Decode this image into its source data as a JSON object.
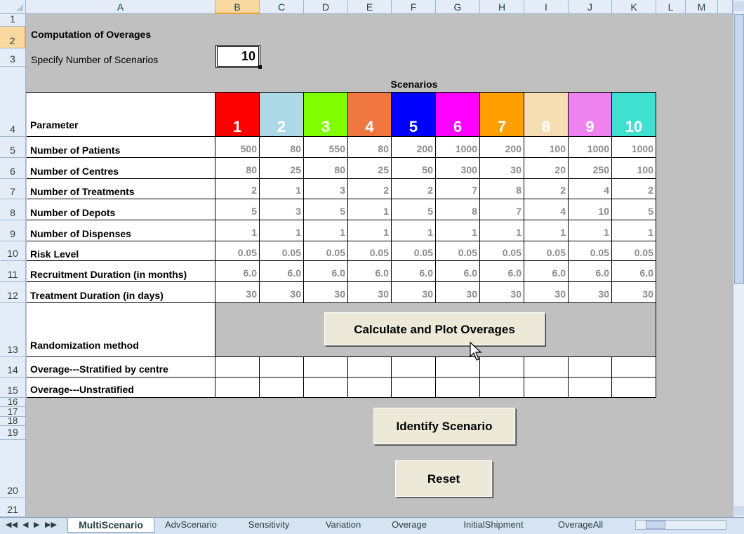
{
  "columns": [
    "A",
    "B",
    "C",
    "D",
    "E",
    "F",
    "G",
    "H",
    "I",
    "J",
    "K",
    "L",
    "M"
  ],
  "rows": [
    "1",
    "2",
    "3",
    "4",
    "5",
    "6",
    "7",
    "8",
    "9",
    "10",
    "11",
    "12",
    "13",
    "14",
    "15",
    "16",
    "17",
    "18",
    "19",
    "20",
    "21"
  ],
  "title": "Computation of Overages",
  "scenario_count_label": "Specify Number of Scenarios",
  "scenario_count_value": "10",
  "scenarios_header": "Scenarios",
  "parameter_label": "Parameter",
  "scenario_numbers": [
    "1",
    "2",
    "3",
    "4",
    "5",
    "6",
    "7",
    "8",
    "9",
    "10"
  ],
  "scenario_colors": [
    "#ff0000",
    "#add8e6",
    "#80ff00",
    "#f07840",
    "#0000ff",
    "#ff00ff",
    "#ffa000",
    "#f5deb3",
    "#ee82ee",
    "#40e0d0"
  ],
  "parameters": [
    {
      "label": "Number of Patients",
      "values": [
        "500",
        "80",
        "550",
        "80",
        "200",
        "1000",
        "200",
        "100",
        "1000",
        "1000"
      ]
    },
    {
      "label": "Number of Centres",
      "values": [
        "80",
        "25",
        "80",
        "25",
        "50",
        "300",
        "30",
        "20",
        "250",
        "100"
      ]
    },
    {
      "label": "Number of Treatments",
      "values": [
        "2",
        "1",
        "3",
        "2",
        "2",
        "7",
        "8",
        "2",
        "4",
        "2"
      ]
    },
    {
      "label": "Number of Depots",
      "values": [
        "5",
        "3",
        "5",
        "1",
        "5",
        "8",
        "7",
        "4",
        "10",
        "5"
      ]
    },
    {
      "label": "Number of Dispenses",
      "values": [
        "1",
        "1",
        "1",
        "1",
        "1",
        "1",
        "1",
        "1",
        "1",
        "1"
      ]
    },
    {
      "label": "Risk Level",
      "values": [
        "0.05",
        "0.05",
        "0.05",
        "0.05",
        "0.05",
        "0.05",
        "0.05",
        "0.05",
        "0.05",
        "0.05"
      ]
    },
    {
      "label": "Recruitment Duration (in months)",
      "values": [
        "6.0",
        "6.0",
        "6.0",
        "6.0",
        "6.0",
        "6.0",
        "6.0",
        "6.0",
        "6.0",
        "6.0"
      ]
    },
    {
      "label": "Treatment Duration (in days)",
      "values": [
        "30",
        "30",
        "30",
        "30",
        "30",
        "30",
        "30",
        "30",
        "30",
        "30"
      ]
    }
  ],
  "randomization_label": "Randomization method",
  "overage_stratified_label": "Overage---Stratified by centre",
  "overage_unstratified_label": "Overage---Unstratified",
  "buttons": {
    "calculate": "Calculate and Plot Overages",
    "identify": "Identify Scenario",
    "reset": "Reset"
  },
  "sheet_tabs": [
    "MultiScenario",
    "AdvScenario",
    "Sensitivity",
    "Variation",
    "Overage",
    "InitialShipment",
    "OverageAll"
  ],
  "active_tab": "MultiScenario"
}
